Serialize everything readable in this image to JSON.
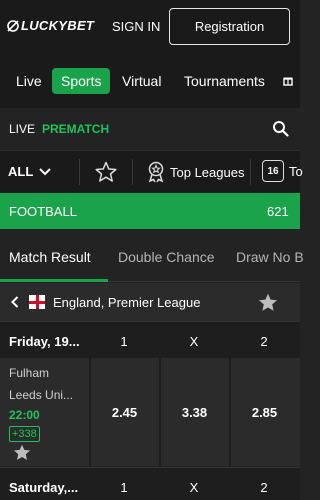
{
  "header": {
    "logo_text": "LUCKYBET",
    "signin_label": "SIGN IN",
    "register_label": "Registration"
  },
  "nav": {
    "items": [
      {
        "label": "Live"
      },
      {
        "label": "Sports",
        "active": true
      },
      {
        "label": "Virtual"
      },
      {
        "label": "Tournaments"
      }
    ]
  },
  "mode": {
    "live_label": "LIVE",
    "prematch_label": "PREMATCH"
  },
  "filters": {
    "all_label": "ALL",
    "top_leagues_label": "Top Leagues",
    "calendar_number": "16",
    "calendar_label": "To"
  },
  "sport": {
    "name": "FOOTBALL",
    "count": "621"
  },
  "market_tabs": [
    {
      "label": "Match Result",
      "active": true
    },
    {
      "label": "Double Chance"
    },
    {
      "label": "Draw No B"
    }
  ],
  "league": {
    "name": "England, Premier League"
  },
  "columns": [
    "1",
    "X",
    "2"
  ],
  "dates": [
    {
      "label": "Friday, 19..."
    },
    {
      "label": "Saturday,..."
    }
  ],
  "match": {
    "home": "Fulham",
    "away": "Leeds Uni...",
    "time": "22:00",
    "markets": "+338",
    "odds": [
      "2.45",
      "3.38",
      "2.85"
    ]
  },
  "colors": {
    "accent": "#1aa34a",
    "accent_text": "#1ec25a",
    "background": "#232323"
  }
}
